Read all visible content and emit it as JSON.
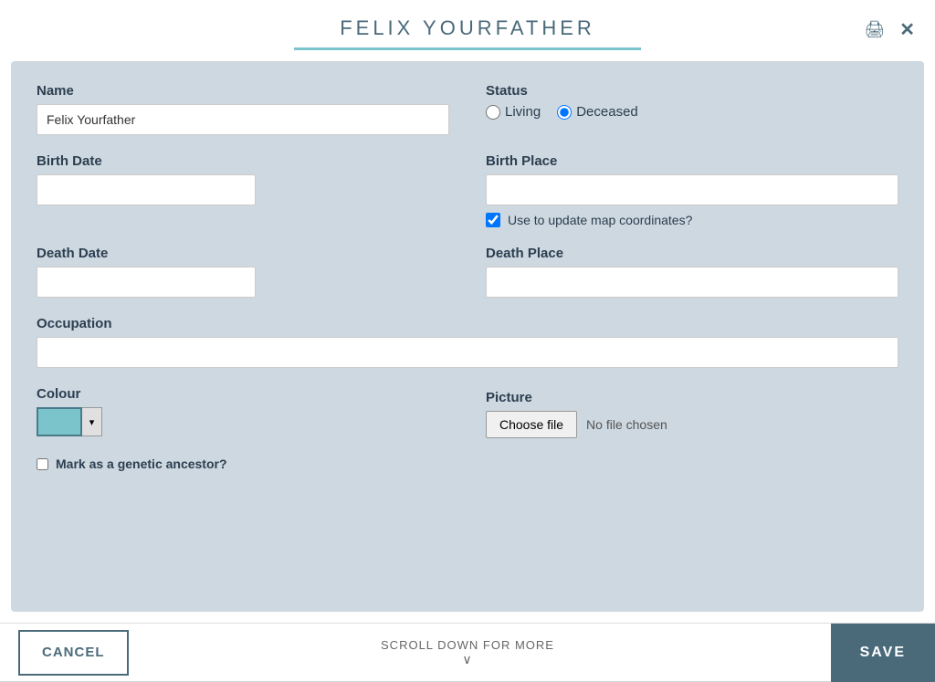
{
  "header": {
    "title": "FELIX YOURFATHER",
    "print_icon": "🖨",
    "close_icon": "✕"
  },
  "form": {
    "name_label": "Name",
    "name_value": "Felix Yourfather",
    "name_placeholder": "",
    "status_label": "Status",
    "status_living_label": "Living",
    "status_deceased_label": "Deceased",
    "status_selected": "deceased",
    "birth_date_label": "Birth Date",
    "birth_date_value": "",
    "birth_place_label": "Birth Place",
    "birth_place_value": "",
    "use_map_label": "Use to update map coordinates?",
    "use_map_checked": true,
    "death_date_label": "Death Date",
    "death_date_value": "",
    "death_place_label": "Death Place",
    "death_place_value": "",
    "occupation_label": "Occupation",
    "occupation_value": "",
    "colour_label": "Colour",
    "colour_value": "#7bc4cc",
    "picture_label": "Picture",
    "choose_file_label": "Choose file",
    "no_file_label": "No file chosen",
    "genetic_label": "Mark as a genetic ancestor?"
  },
  "footer": {
    "cancel_label": "CANCEL",
    "scroll_label": "SCROLL DOWN FOR MORE",
    "save_label": "SAVE"
  }
}
